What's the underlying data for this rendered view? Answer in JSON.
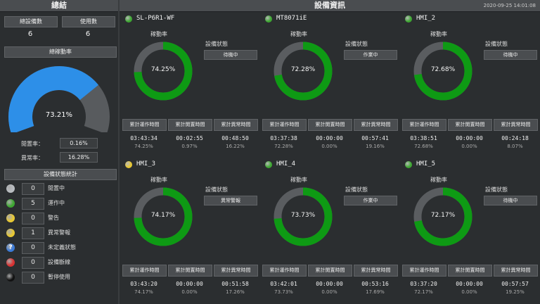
{
  "left": {
    "title": "總結",
    "total_label": "總設備數",
    "total_value": "6",
    "inuse_label": "使用數",
    "inuse_value": "6",
    "rate_title": "總稼動率",
    "rate_value": "73.21%",
    "rate_fraction": 0.7321,
    "idle_label": "閒置率：",
    "idle_value": "0.16%",
    "abnormal_label": "異常率：",
    "abnormal_value": "16.28%",
    "stats_title": "設備狀態統計",
    "stats": [
      {
        "label": "閒置中",
        "count": "0",
        "color": "#b8bcc0",
        "icon": "gray-status-dot"
      },
      {
        "label": "運作中",
        "count": "5",
        "color": "#3ea832",
        "icon": "green-status-dot"
      },
      {
        "label": "警告",
        "count": "0",
        "color": "#e8c832",
        "icon": "yellow-status-dot"
      },
      {
        "label": "異常警報",
        "count": "1",
        "color": "#e8c832",
        "icon": "yellow-status-dot"
      },
      {
        "label": "未定義狀態",
        "count": "0",
        "color": "#3a7ad8",
        "icon": "question-icon"
      },
      {
        "label": "設備斷線",
        "count": "0",
        "color": "#d83232",
        "icon": "red-status-dot"
      },
      {
        "label": "暫停使用",
        "count": "0",
        "color": "#111111",
        "icon": "black-status-dot"
      }
    ]
  },
  "right": {
    "title": "設備資訊",
    "datetime": "2020-09-25 14:01:08"
  },
  "common": {
    "rate_label": "稼動率",
    "state_label": "設備狀態",
    "btn_run": "累計運作時間",
    "btn_idle": "累計閒置時間",
    "btn_abn": "累計異常時間"
  },
  "devices": [
    {
      "name": "SL-P6R1-WF",
      "dot": "#3ea832",
      "rate": "74.25%",
      "rate_fraction": 0.7425,
      "state": "待機中",
      "run": "03:43:34",
      "run_pct": "74.25%",
      "idle": "00:02:55",
      "idle_pct": "0.97%",
      "abn": "00:48:50",
      "abn_pct": "16.22%"
    },
    {
      "name": "MT8071iE",
      "dot": "#3ea832",
      "rate": "72.28%",
      "rate_fraction": 0.7228,
      "state": "作業中",
      "run": "03:37:38",
      "run_pct": "72.28%",
      "idle": "00:00:00",
      "idle_pct": "0.00%",
      "abn": "00:57:41",
      "abn_pct": "19.16%"
    },
    {
      "name": "HMI_2",
      "dot": "#3ea832",
      "rate": "72.68%",
      "rate_fraction": 0.7268,
      "state": "待機中",
      "run": "03:38:51",
      "run_pct": "72.68%",
      "idle": "00:00:00",
      "idle_pct": "0.00%",
      "abn": "00:24:18",
      "abn_pct": "8.07%"
    },
    {
      "name": "HMI_3",
      "dot": "#e8c832",
      "rate": "74.17%",
      "rate_fraction": 0.7417,
      "state": "異常警報",
      "run": "03:43:20",
      "run_pct": "74.17%",
      "idle": "00:00:00",
      "idle_pct": "0.00%",
      "abn": "00:51:58",
      "abn_pct": "17.26%"
    },
    {
      "name": "HMI_4",
      "dot": "#3ea832",
      "rate": "73.73%",
      "rate_fraction": 0.7373,
      "state": "作業中",
      "run": "03:42:01",
      "run_pct": "73.73%",
      "idle": "00:00:00",
      "idle_pct": "0.00%",
      "abn": "00:53:16",
      "abn_pct": "17.69%"
    },
    {
      "name": "HMI_5",
      "dot": "#3ea832",
      "rate": "72.17%",
      "rate_fraction": 0.7217,
      "state": "待機中",
      "run": "03:37:20",
      "run_pct": "72.17%",
      "idle": "00:00:00",
      "idle_pct": "0.00%",
      "abn": "00:57:57",
      "abn_pct": "19.25%"
    }
  ]
}
